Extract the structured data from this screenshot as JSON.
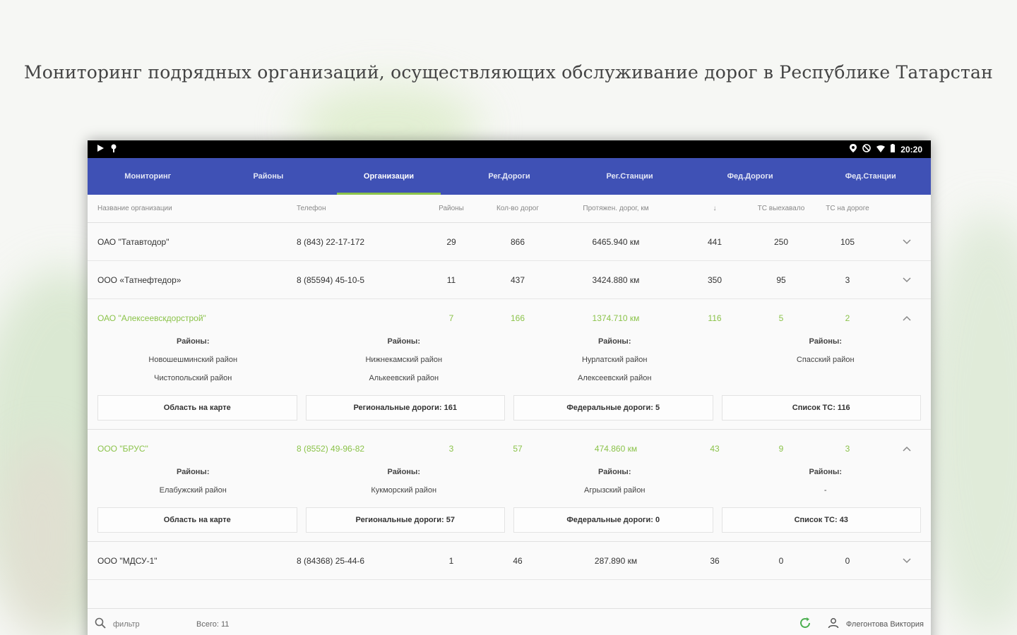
{
  "page_title": "Мониторинг подрядных организаций, осуществляющих обслуживание дорог в Республике Татарстан",
  "status_bar": {
    "left_icons": [
      "play-icon",
      "location-pin-icon"
    ],
    "right_icons": [
      "location-icon",
      "no-disturb-icon",
      "wifi-icon",
      "battery-icon"
    ],
    "time": "20:20"
  },
  "tabs": [
    {
      "label": "Мониторинг",
      "active": false
    },
    {
      "label": "Районы",
      "active": false
    },
    {
      "label": "Организации",
      "active": true
    },
    {
      "label": "Рег.Дороги",
      "active": false
    },
    {
      "label": "Рег.Станции",
      "active": false
    },
    {
      "label": "Фед.Дороги",
      "active": false
    },
    {
      "label": "Фед.Станции",
      "active": false
    }
  ],
  "columns": {
    "name": "Название организации",
    "phone": "Телефон",
    "districts": "Районы",
    "roads_count": "Кол-во дорог",
    "length": "Протяжен. дорог, км",
    "sort": "↓",
    "vehicles_out": "ТС выехавало",
    "vehicles_road": "ТС на дороге"
  },
  "rows": [
    {
      "name": "ОАО \"Татавтодор\"",
      "phone": "8 (843) 22-17-172",
      "districts": "29",
      "roads": "866",
      "length": "6465.940 км",
      "col5": "441",
      "out": "250",
      "road": "105",
      "expanded": false
    },
    {
      "name": "ООО «Татнефтедор»",
      "phone": "8 (85594) 45-10-5",
      "districts": "11",
      "roads": "437",
      "length": "3424.880 км",
      "col5": "350",
      "out": "95",
      "road": "3",
      "expanded": false
    },
    {
      "name": "ОАО \"Алексеевскдорстрой\"",
      "phone": "",
      "districts": "7",
      "roads": "166",
      "length": "1374.710 км",
      "col5": "116",
      "out": "5",
      "road": "2",
      "expanded": true,
      "districts_label": "Районы:",
      "district_cols": [
        [
          "Новошешминский район",
          "Чистопольский район"
        ],
        [
          "Нижнекамский район",
          "Алькеевский район"
        ],
        [
          "Нурлатский район",
          "Алексеевский район"
        ],
        [
          "Спасский район"
        ]
      ],
      "buttons": [
        "Область на карте",
        "Региональные дороги: 161",
        "Федеральные дороги: 5",
        "Список ТС: 116"
      ]
    },
    {
      "name": "ООО \"БРУС\"",
      "phone": "8 (8552) 49-96-82",
      "districts": "3",
      "roads": "57",
      "length": "474.860 км",
      "col5": "43",
      "out": "9",
      "road": "3",
      "expanded": true,
      "districts_label": "Районы:",
      "district_cols": [
        [
          "Елабужский район"
        ],
        [
          "Кукморский район"
        ],
        [
          "Агрызский район"
        ],
        [
          "-"
        ]
      ],
      "buttons": [
        "Область на карте",
        "Региональные дороги: 57",
        "Федеральные дороги: 0",
        "Список ТС: 43"
      ]
    },
    {
      "name": "ООО \"МДСУ-1\"",
      "phone": "8 (84368) 25-44-6",
      "districts": "1",
      "roads": "46",
      "length": "287.890 км",
      "col5": "36",
      "out": "0",
      "road": "0",
      "expanded": false
    }
  ],
  "footer": {
    "filter_placeholder": "фильтр",
    "total": "Всего: 11",
    "user": "Флегонтова Виктория"
  },
  "colors": {
    "tab_bar": "#3f51b5",
    "accent_green": "#8bc34a",
    "status_bar": "#000000"
  }
}
